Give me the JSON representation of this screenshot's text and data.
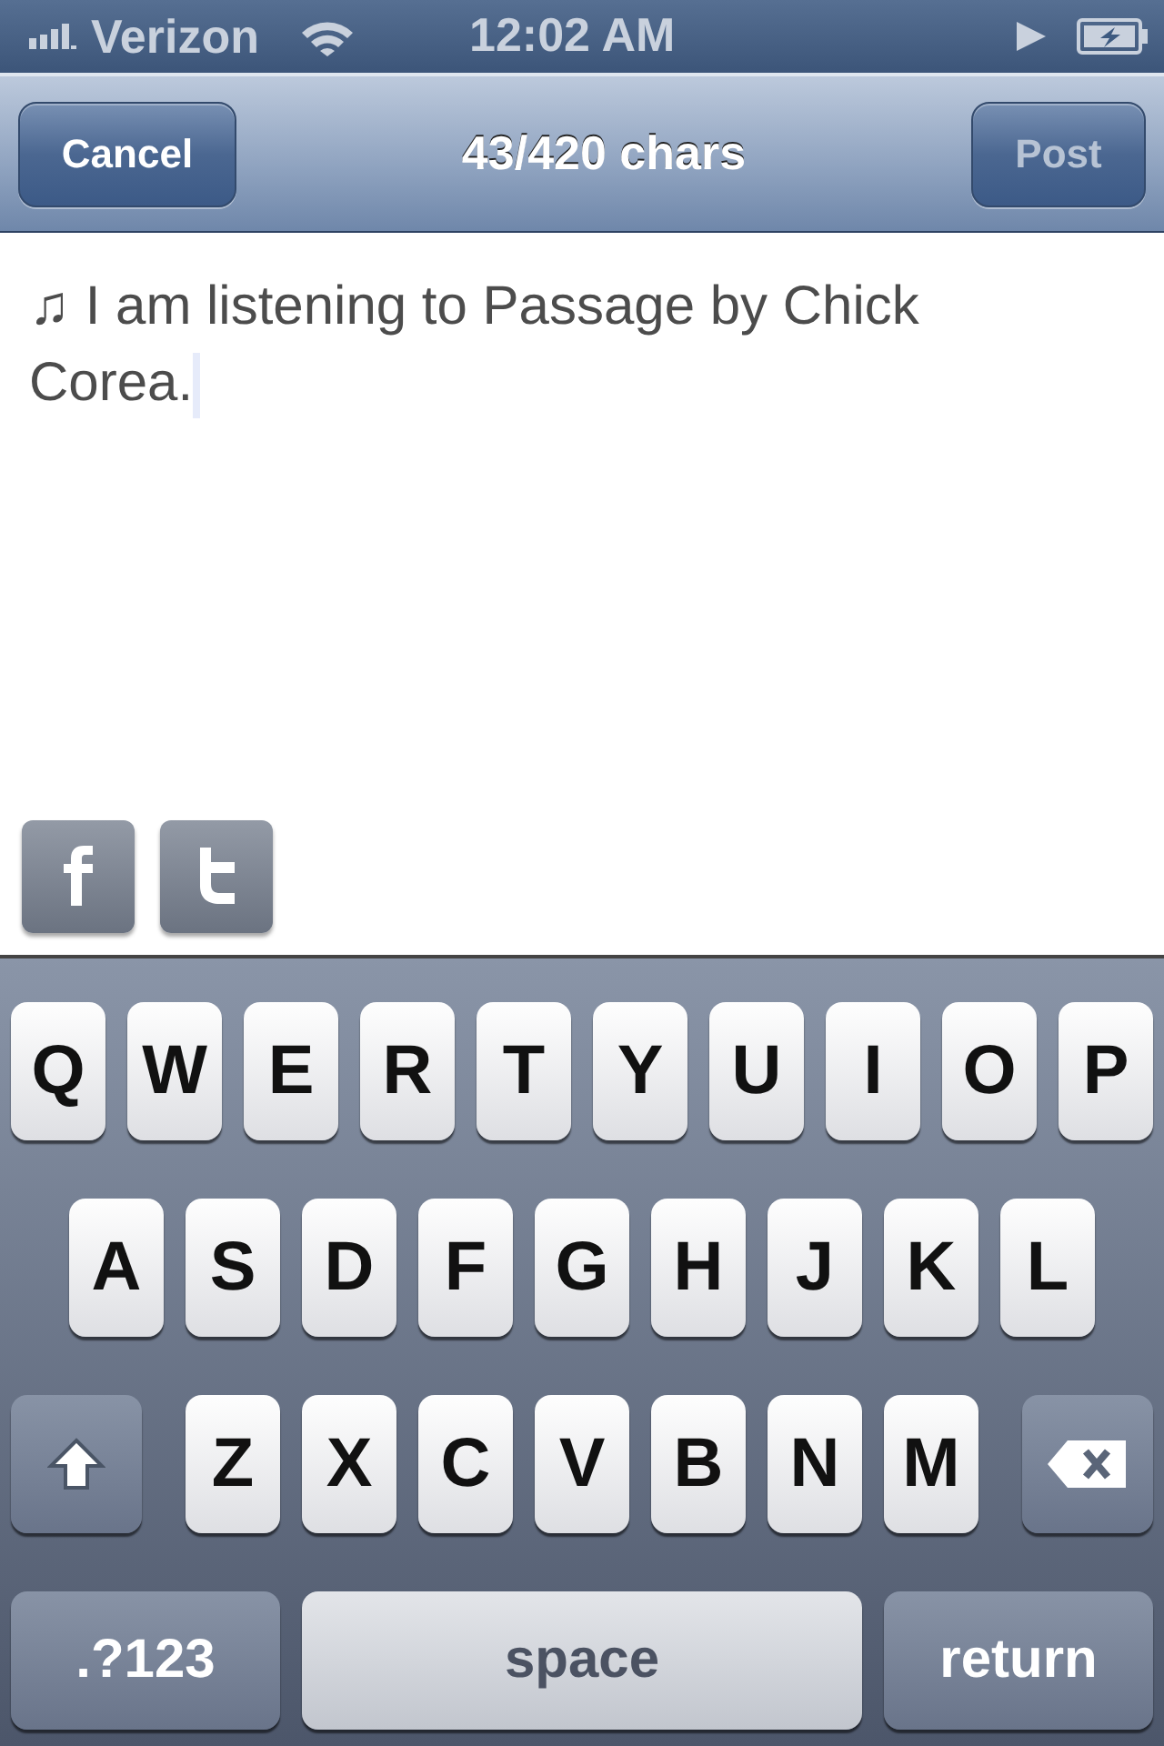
{
  "status_bar": {
    "carrier": "Verizon",
    "time": "12:02 AM"
  },
  "nav_bar": {
    "title": "43/420 chars",
    "left_button": {
      "label": "Cancel",
      "disabled": false
    },
    "right_button": {
      "label": "Post",
      "disabled": true
    }
  },
  "composer": {
    "value": "♫ I am listening to Passage by Chick Corea."
  },
  "share_toggles": [
    {
      "kind": "f",
      "on": false
    },
    {
      "kind": "t",
      "on": false
    }
  ],
  "keyboard": {
    "key_rows": [
      {
        "keys": [
          {
            "kind": "letter",
            "label": "Q"
          },
          {
            "kind": "letter",
            "label": "W"
          },
          {
            "kind": "letter",
            "label": "E"
          },
          {
            "kind": "letter",
            "label": "R"
          },
          {
            "kind": "letter",
            "label": "T"
          },
          {
            "kind": "letter",
            "label": "Y"
          },
          {
            "kind": "letter",
            "label": "U"
          },
          {
            "kind": "letter",
            "label": "I"
          },
          {
            "kind": "letter",
            "label": "O"
          },
          {
            "kind": "letter",
            "label": "P"
          }
        ]
      },
      {
        "keys": [
          {
            "kind": "letter",
            "label": "A"
          },
          {
            "kind": "letter",
            "label": "S"
          },
          {
            "kind": "letter",
            "label": "D"
          },
          {
            "kind": "letter",
            "label": "F"
          },
          {
            "kind": "letter",
            "label": "G"
          },
          {
            "kind": "letter",
            "label": "H"
          },
          {
            "kind": "letter",
            "label": "J"
          },
          {
            "kind": "letter",
            "label": "K"
          },
          {
            "kind": "letter",
            "label": "L"
          }
        ]
      },
      {
        "keys": [
          {
            "kind": "shift"
          },
          {
            "kind": "letter",
            "label": "Z"
          },
          {
            "kind": "letter",
            "label": "X"
          },
          {
            "kind": "letter",
            "label": "C"
          },
          {
            "kind": "letter",
            "label": "V"
          },
          {
            "kind": "letter",
            "label": "B"
          },
          {
            "kind": "letter",
            "label": "N"
          },
          {
            "kind": "letter",
            "label": "M"
          },
          {
            "kind": "delete"
          }
        ]
      },
      {
        "keys": [
          {
            "kind": "mode",
            "label": ".?123"
          },
          {
            "kind": "space",
            "label": "space"
          },
          {
            "kind": "return",
            "label": "return"
          }
        ]
      }
    ]
  }
}
